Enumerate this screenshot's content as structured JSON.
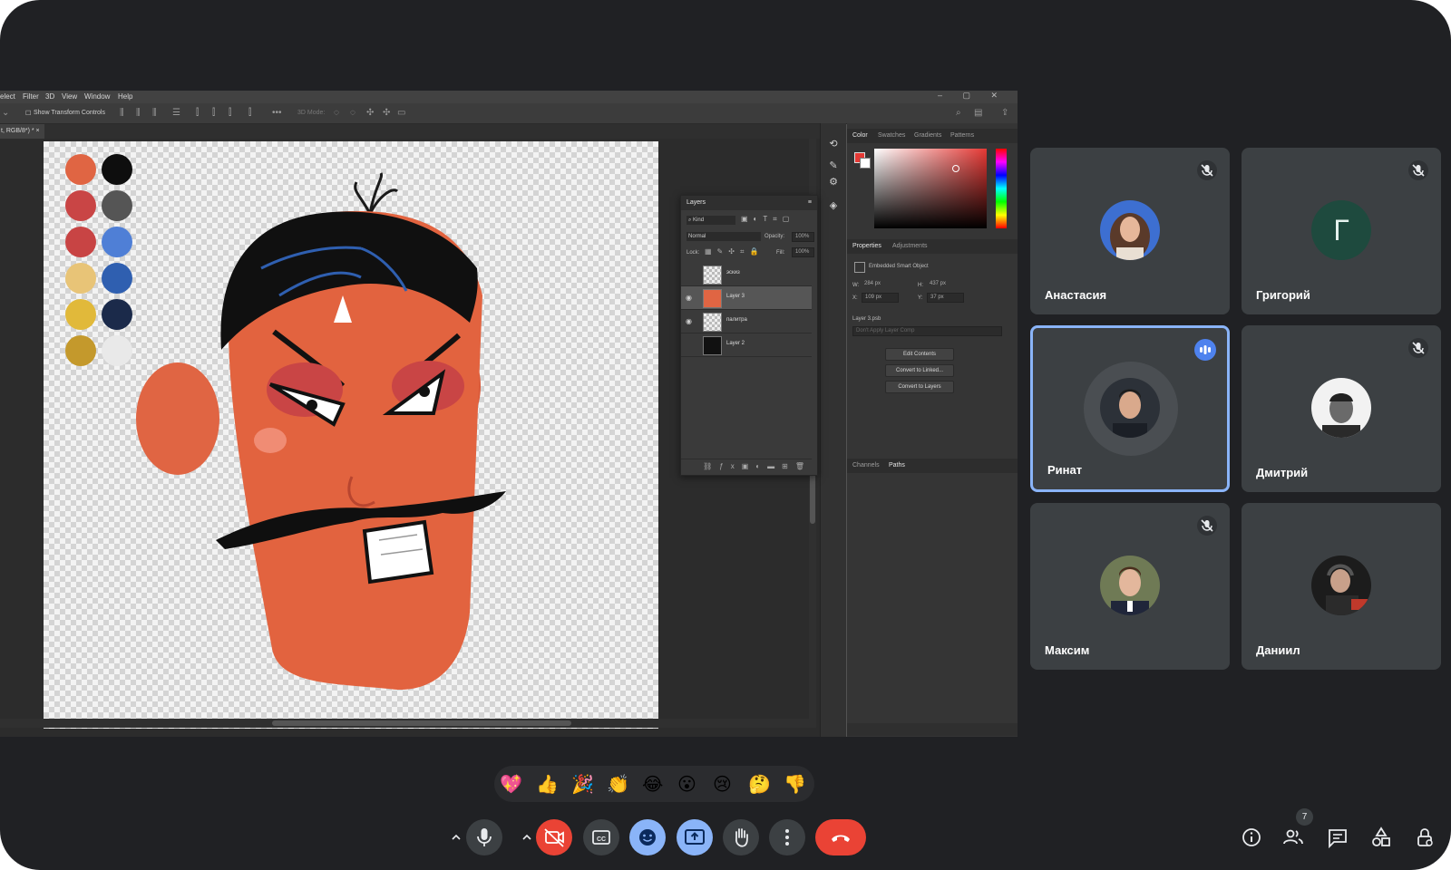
{
  "photoshop": {
    "menu": [
      "elect",
      "Filter",
      "3D",
      "View",
      "Window",
      "Help"
    ],
    "options": {
      "show_transform": "Show Transform Controls",
      "mode_3d": "3D Mode:"
    },
    "doc_tab": "t, RGB/8*) *",
    "layers_panel": {
      "title": "Layers",
      "filter": "Kind",
      "blend_mode": "Normal",
      "opacity_label": "Opacity:",
      "opacity_value": "100%",
      "lock_label": "Lock:",
      "fill_label": "Fill:",
      "fill_value": "100%",
      "layers": [
        {
          "name": "эскиз",
          "visible": false,
          "selected": false
        },
        {
          "name": "Layer 3",
          "visible": true,
          "selected": true
        },
        {
          "name": "палитра",
          "visible": true,
          "selected": false
        },
        {
          "name": "Layer 2",
          "visible": false,
          "selected": false
        }
      ]
    },
    "color_panel": {
      "tabs": [
        "Color",
        "Swatches",
        "Gradients",
        "Patterns"
      ],
      "active": "Color",
      "foreground": "#e53935"
    },
    "properties_panel": {
      "tabs": [
        "Properties",
        "Adjustments"
      ],
      "object_type": "Embedded Smart Object",
      "w_label": "W:",
      "w": "284 px",
      "h_label": "H:",
      "h": "437 px",
      "x_label": "X:",
      "x": "109 px",
      "y_label": "Y:",
      "y": "37 px",
      "file": "Layer 3.psb",
      "layer_comp_placeholder": "Don't Apply Layer Comp",
      "buttons": [
        "Edit Contents",
        "Convert to Linked...",
        "Convert to Layers"
      ]
    },
    "channels_panel": {
      "tabs": [
        "Channels",
        "Paths"
      ]
    },
    "palette_swatches": [
      "#e06543",
      "#0e0e0e",
      "#c94545",
      "#555555",
      "#c84444",
      "#4f7fd6",
      "#e8c477",
      "#2f5fb0",
      "#e1b93a",
      "#1b2a4a",
      "#c4992c",
      "#e9e9e9"
    ]
  },
  "participants": [
    {
      "name": "Анастасия",
      "muted": true,
      "speaking": false
    },
    {
      "name": "Григорий",
      "initial": "Г",
      "muted": true,
      "speaking": false
    },
    {
      "name": "Ринат",
      "muted": false,
      "speaking": true
    },
    {
      "name": "Дмитрий",
      "muted": true,
      "speaking": false
    },
    {
      "name": "Максим",
      "muted": true,
      "speaking": false
    },
    {
      "name": "Даниил",
      "muted": false,
      "speaking": false
    }
  ],
  "reactions": [
    "💖",
    "👍",
    "🎉",
    "👏",
    "😂",
    "😮",
    "😢",
    "🤔",
    "👎"
  ],
  "controls": {
    "mic": "mic-icon",
    "camera": "camera-off-icon",
    "captions": "captions-icon",
    "emoji": "emoji-icon",
    "present": "present-screen-icon",
    "raise_hand": "raise-hand-icon",
    "more": "more-options-icon",
    "leave": "leave-call-icon"
  },
  "right_controls": {
    "people_count": "7"
  },
  "colors": {
    "accent": "#8ab4f8",
    "leave": "#ea4335",
    "active_button": "#8ab4f8",
    "speaking": "#4e82ee"
  }
}
